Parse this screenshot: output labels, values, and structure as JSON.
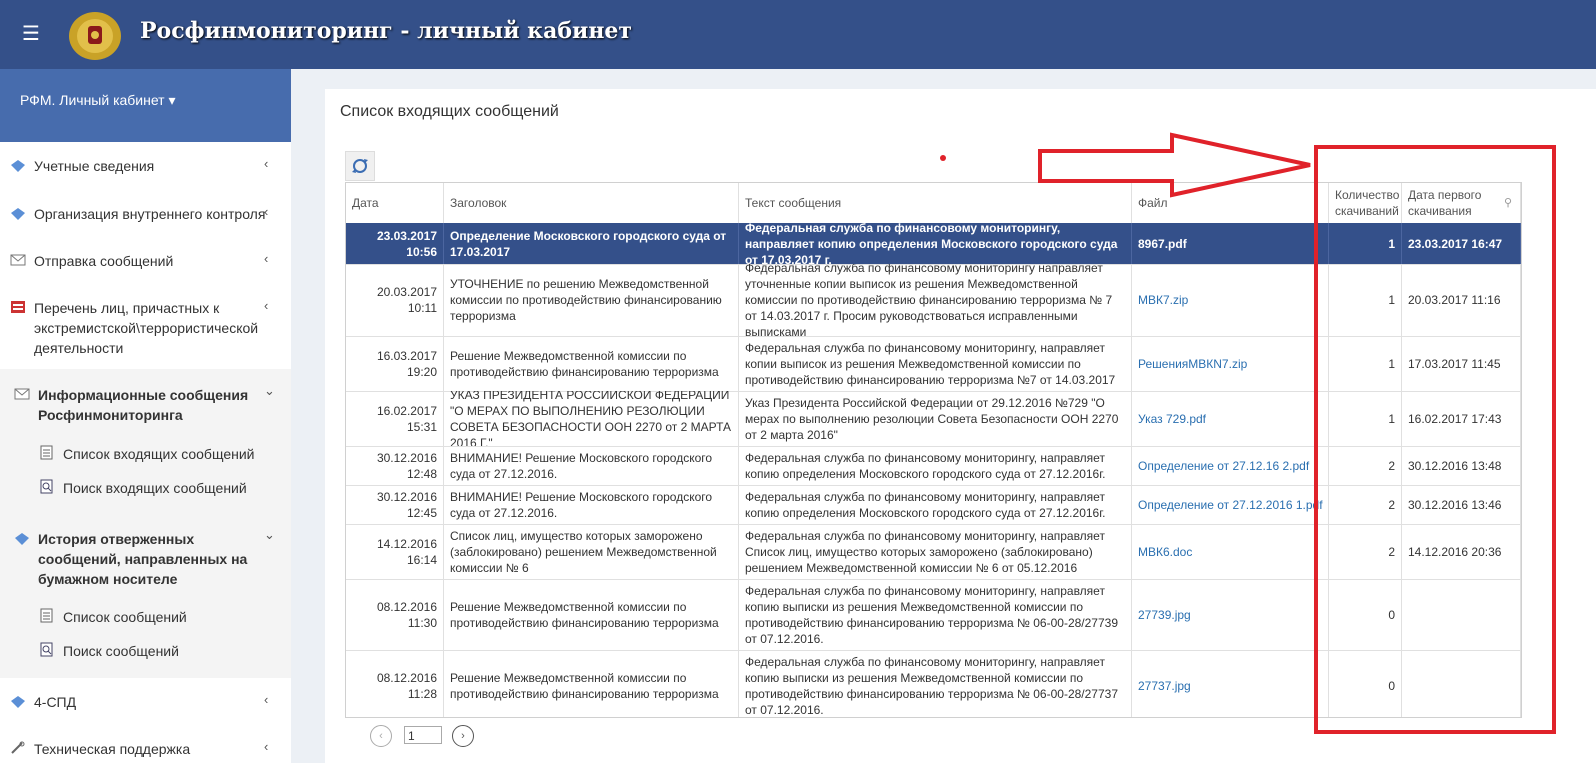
{
  "header": {
    "title": "Росфинмониторинг - личный кабинет",
    "menu_icon": "☰"
  },
  "sidebar": {
    "account_label": "РФМ. Личный кабинет",
    "caret": "▾",
    "items": [
      {
        "label": "Учетные сведения",
        "icon": "diamond-icon"
      },
      {
        "label": "Организация внутреннего контроля",
        "icon": "diamond-icon"
      },
      {
        "label": "Отправка сообщений",
        "icon": "envelope-icon"
      },
      {
        "label": "Перечень лиц, причастных к экстремистской\\террористической деятельности",
        "icon": "list-icon"
      },
      {
        "label": "Информационные сообщения Росфинмониторинга",
        "icon": "envelope-icon"
      },
      {
        "label": "Список входящих сообщений",
        "icon": "document-icon"
      },
      {
        "label": "Поиск входящих сообщений",
        "icon": "search-doc-icon"
      },
      {
        "label": "История отверженных сообщений, направленных на бумажном носителе",
        "icon": "diamond-icon"
      },
      {
        "label": "Список сообщений",
        "icon": "document-icon"
      },
      {
        "label": "Поиск сообщений",
        "icon": "search-doc-icon"
      },
      {
        "label": "4-СПД",
        "icon": "diamond-icon"
      },
      {
        "label": "Техническая поддержка",
        "icon": "tools-icon"
      }
    ],
    "chevron_left": "‹",
    "chevron_down": "⌄"
  },
  "main": {
    "title": "Список входящих сообщений",
    "table": {
      "columns": [
        "Дата",
        "Заголовок",
        "Текст сообщения",
        "Файл",
        "Количество скачиваний",
        "Дата первого скачивания"
      ],
      "rows": [
        {
          "date": "23.03.2017 10:56",
          "title": "Определение Московского городского суда от 17.03.2017",
          "text": "Федеральная служба по финансовому мониторингу, направляет копию определения Московского городского суда от 17.03.2017 г.",
          "file": "8967.pdf",
          "count": "1",
          "first": "23.03.2017 16:47",
          "selected": true
        },
        {
          "date": "20.03.2017 10:11",
          "title": "УТОЧНЕНИЕ по решению Межведомственной комиссии по противодействию финансированию терроризма",
          "text": "Федеральная служба по финансовому мониторингу направляет уточненные копии выписок из решения Межведомственной комиссии по противодействию финансированию терроризма № 7 от 14.03.2017 г. Просим руководствоваться исправленными выписками",
          "file": "МВК7.zip",
          "count": "1",
          "first": "20.03.2017 11:16"
        },
        {
          "date": "16.03.2017 19:20",
          "title": "Решение Межведомственной комиссии по противодействию финансированию терроризма",
          "text": "Федеральная служба по финансовому мониторингу, направляет копии выписок из решения Межведомственной комиссии по противодействию финансированию терроризма №7 от 14.03.2017",
          "file": "РешенияМВКN7.zip",
          "count": "1",
          "first": "17.03.2017 11:45"
        },
        {
          "date": "16.02.2017 15:31",
          "title": "УКАЗ ПРЕЗИДЕНТА РОССИЙСКОЙ ФЕДЕРАЦИИ \"О МЕРАХ ПО ВЫПОЛНЕНИЮ РЕЗОЛЮЦИИ СОВЕТА БЕЗОПАСНОСТИ ООН 2270 от 2 МАРТА 2016 Г.\"",
          "text": "Указ Президента Российской Федерации от 29.12.2016 №729 \"О мерах по выполнению резолюции Совета Безопасности ООН 2270 от 2 марта 2016\"",
          "file": "Указ 729.pdf",
          "count": "1",
          "first": "16.02.2017 17:43"
        },
        {
          "date": "30.12.2016 12:48",
          "title": "ВНИМАНИЕ! Решение Московского городского суда от 27.12.2016.",
          "text": "Федеральная служба по финансовому мониторингу, направляет копию определения Московского городского суда от 27.12.2016г.",
          "file": "Определение от 27.12.16 2.pdf",
          "count": "2",
          "first": "30.12.2016 13:48"
        },
        {
          "date": "30.12.2016 12:45",
          "title": "ВНИМАНИЕ! Решение Московского городского суда от 27.12.2016.",
          "text": "Федеральная служба по финансовому мониторингу, направляет копию определения Московского городского суда от 27.12.2016г.",
          "file": "Определение от 27.12.2016 1.pdf",
          "count": "2",
          "first": "30.12.2016 13:46"
        },
        {
          "date": "14.12.2016 16:14",
          "title": "Список лиц, имущество которых заморожено (заблокировано) решением Межведомственной комиссии № 6",
          "text": "Федеральная служба по финансовому мониторингу, направляет Список лиц, имущество которых заморожено (заблокировано) решением Межведомственной комиссии № 6 от 05.12.2016",
          "file": "МВК6.doc",
          "count": "2",
          "first": "14.12.2016 20:36"
        },
        {
          "date": "08.12.2016 11:30",
          "title": "Решение Межведомственной комиссии по противодействию финансированию терроризма",
          "text": "Федеральная служба по финансовому мониторингу, направляет копию выписки из решения Межведомственной комиссии по противодействию финансированию терроризма № 06-00-28/27739 от 07.12.2016.",
          "file": "27739.jpg",
          "count": "0",
          "first": ""
        },
        {
          "date": "08.12.2016 11:28",
          "title": "Решение Межведомственной комиссии по противодействию финансированию терроризма",
          "text": "Федеральная служба по финансовому мониторингу, направляет копию выписки из решения Межведомственной комиссии по противодействию финансированию терроризма № 06-00-28/27737 от 07.12.2016.",
          "file": "27737.jpg",
          "count": "0",
          "first": ""
        }
      ]
    },
    "pager": {
      "page": "1",
      "prev": "‹",
      "next": "›"
    },
    "filter_icon": "pin-icon"
  },
  "colors": {
    "header": "#345089",
    "sidebar_head": "#476cad",
    "selected_row": "#34508a",
    "link": "#2a6fb0",
    "annotation": "#e0222a"
  }
}
